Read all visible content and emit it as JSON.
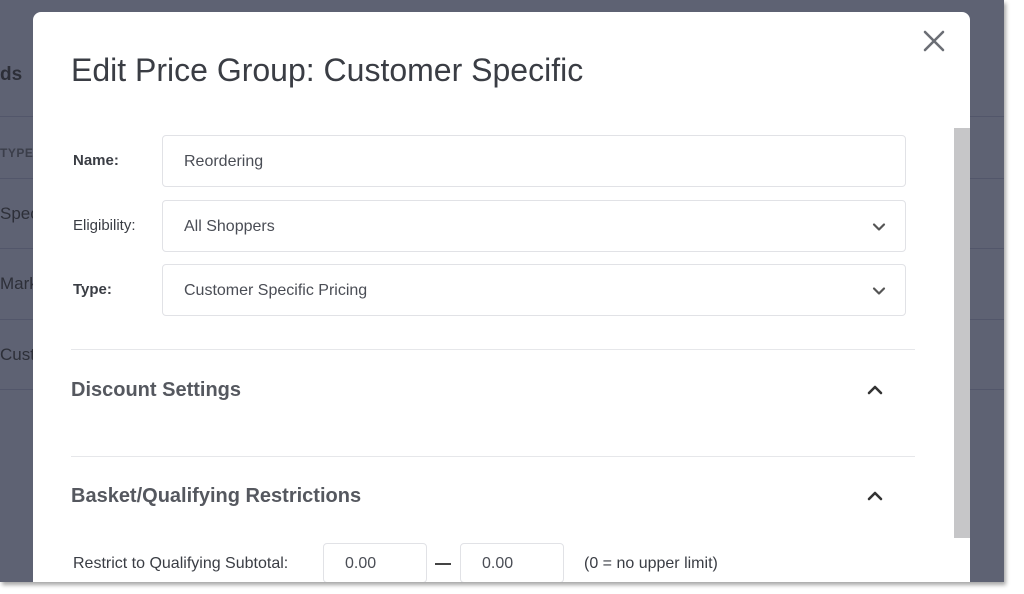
{
  "background": {
    "heading_fragment": "ds",
    "column_fragment": "TYPE",
    "row_fragments": [
      "Spec",
      "Mark",
      "Cust"
    ]
  },
  "modal": {
    "title": "Edit Price Group: Customer Specific",
    "close_icon": "close-icon"
  },
  "form": {
    "name": {
      "label": "Name:",
      "value": "Reordering"
    },
    "eligibility": {
      "label": "Eligibility:",
      "value": "All Shoppers"
    },
    "type": {
      "label": "Type:",
      "value": "Customer Specific Pricing"
    }
  },
  "sections": {
    "discount": {
      "title": "Discount Settings",
      "toggle_icon": "chevron-up-icon"
    },
    "basket": {
      "title": "Basket/Qualifying Restrictions",
      "toggle_icon": "chevron-up-icon"
    }
  },
  "subtotal": {
    "label": "Restrict to Qualifying Subtotal:",
    "min": "0.00",
    "max": "0.00",
    "hint": "(0 = no upper limit)"
  },
  "colors": {
    "overlay": "#5b5f72",
    "modal_bg": "#ffffff",
    "text": "#3a3d44",
    "border": "#e1e2e6",
    "scrollbar": "#c6c6c8"
  }
}
